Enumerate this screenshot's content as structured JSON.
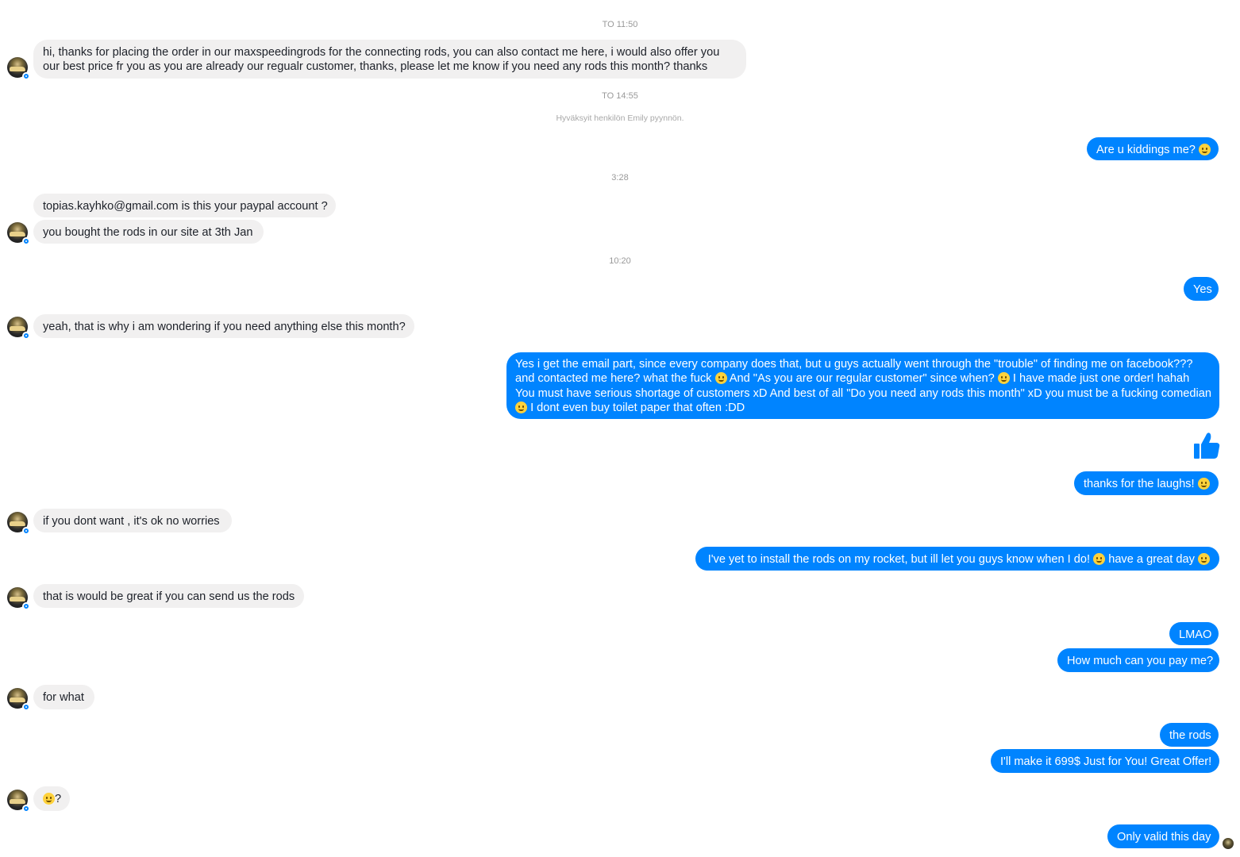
{
  "timestamps": {
    "t1": "TO 11:50",
    "t2": "TO 14:55",
    "t3": "3:28",
    "t4": "10:20"
  },
  "system_notice": "Hyväksyit henkilön Emily pyynnön.",
  "messages": {
    "m1": "hi, thanks for placing the order in our maxspeedingrods for the connecting rods, you can also contact me here, i would also offer you our best price fr you as you are already our regualr customer, thanks, please let me know if you need any rods this month? thanks",
    "m2_text": "Are u kiddings me?",
    "m2_emoji": "grinning-face-emoji",
    "m3": "topias.kayhko@gmail.com  is this your paypal account ?",
    "m4": "you bought the rods in our site at 3th Jan",
    "m5": "Yes",
    "m6": "yeah, that is why i am wondering if you need anything else this month?",
    "m7_a": "Yes i get the email part, since every company does that, but u guys actually went through the \"trouble\" of finding me on facebook??? and contacted me here? what the fuck",
    "m7_b": "And \"As you are our regular customer\" since when?",
    "m7_c": "I have made just one order! hahah You must have serious shortage of customers xD And best of all \"Do you need any rods this month\" xD you must be a fucking comedian",
    "m7_d": "I dont even buy toilet paper that often :DD",
    "m8_emoji": "thumbs-up-like",
    "m9": "thanks for the laughs!",
    "m10": "if you dont want , it's ok no worries",
    "m11_a": "I've yet to install the rods on my rocket, but ill let you guys know when I do!",
    "m11_b": "have a great day",
    "m12": "that is would be great if you can send us the rods",
    "m13": "LMAO",
    "m14": "How much can you pay me?",
    "m15": "for what",
    "m16": "the rods",
    "m17": "I'll make it 699$ Just for You! Great Offer!",
    "m18_emoji": "screaming-face-emoji",
    "m18_text": "?",
    "m19": "Only valid this day"
  },
  "colors": {
    "outgoing": "#0084ff",
    "incoming": "#f1f0f0",
    "incoming_text": "#1d2129"
  }
}
